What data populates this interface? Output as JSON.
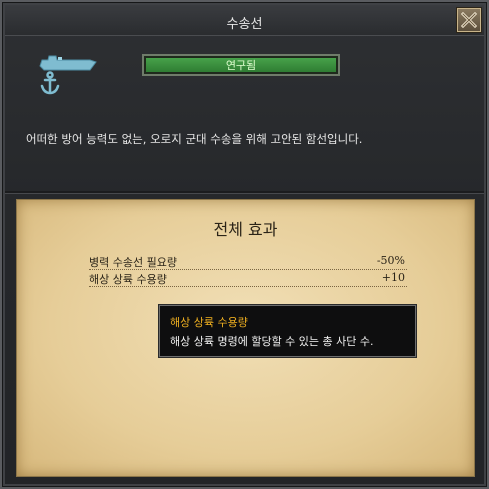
{
  "window": {
    "title": "수송선"
  },
  "status": {
    "label": "연구됨"
  },
  "description": "어떠한 방어 능력도 없는, 오로지 군대 수송을 위해 고안된 함선입니다.",
  "effects": {
    "title": "전체 효과",
    "rows": [
      {
        "label": "병력 수송선 필요량",
        "value": "-50%"
      },
      {
        "label": "해상 상륙 수용량",
        "value": "+10"
      }
    ]
  },
  "tooltip": {
    "title": "해상 상륙 수용량",
    "text": "해상 상륙 명령에 할당할 수 있는 총 사단 수."
  },
  "colors": {
    "status_green": "#47a14a",
    "tooltip_title": "#f0b020",
    "parchment": "#e6cd98"
  },
  "icons": {
    "ship": "transport-ship-icon",
    "anchor": "anchor-icon",
    "close": "close-icon"
  }
}
